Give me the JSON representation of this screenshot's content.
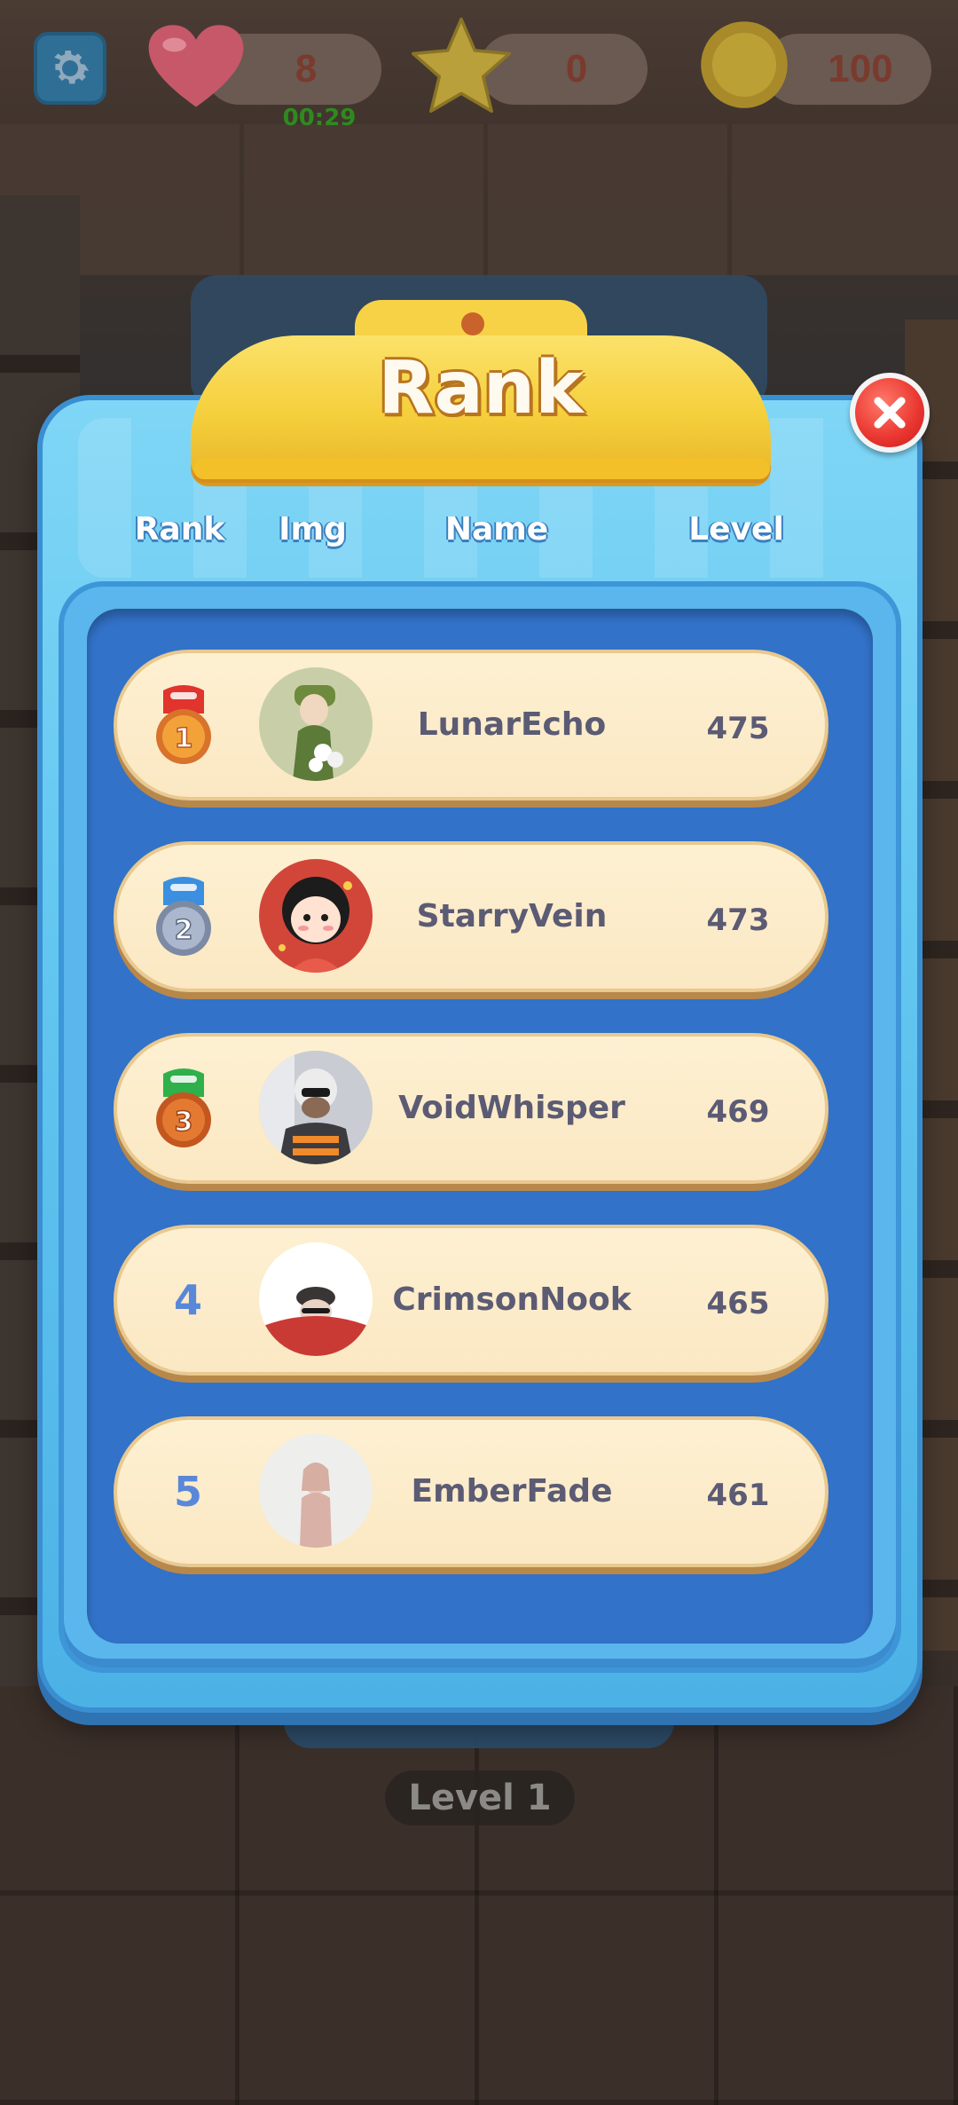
{
  "hud": {
    "lives": "8",
    "lives_timer": "00:29",
    "stars": "0",
    "coins": "100",
    "icons": [
      "gear-icon",
      "heart-icon",
      "star-icon",
      "coin-icon"
    ]
  },
  "dialog": {
    "title": "Rank",
    "columns": {
      "rank": "Rank",
      "img": "Img",
      "name": "Name",
      "level": "Level"
    },
    "close_icon": "close-icon",
    "rows": [
      {
        "rank": "1",
        "name": "LunarEcho",
        "level": "475",
        "medal": "gold",
        "ribbon": "#e0342c"
      },
      {
        "rank": "2",
        "name": "StarryVein",
        "level": "473",
        "medal": "silver",
        "ribbon": "#3a8fe0"
      },
      {
        "rank": "3",
        "name": "VoidWhisper",
        "level": "469",
        "medal": "bronze",
        "ribbon": "#2fb04a"
      },
      {
        "rank": "4",
        "name": "CrimsonNook",
        "level": "465",
        "medal": "",
        "ribbon": ""
      },
      {
        "rank": "5",
        "name": "EmberFade",
        "level": "461",
        "medal": "",
        "ribbon": ""
      }
    ]
  },
  "background": {
    "level_label": "Level 1"
  },
  "colors": {
    "panel_blue": "#63c7f0",
    "list_blue": "#3272c8",
    "header_yellow": "#f5cf3c",
    "row_cream": "#fdf0d2",
    "close_red": "#e9352f"
  }
}
